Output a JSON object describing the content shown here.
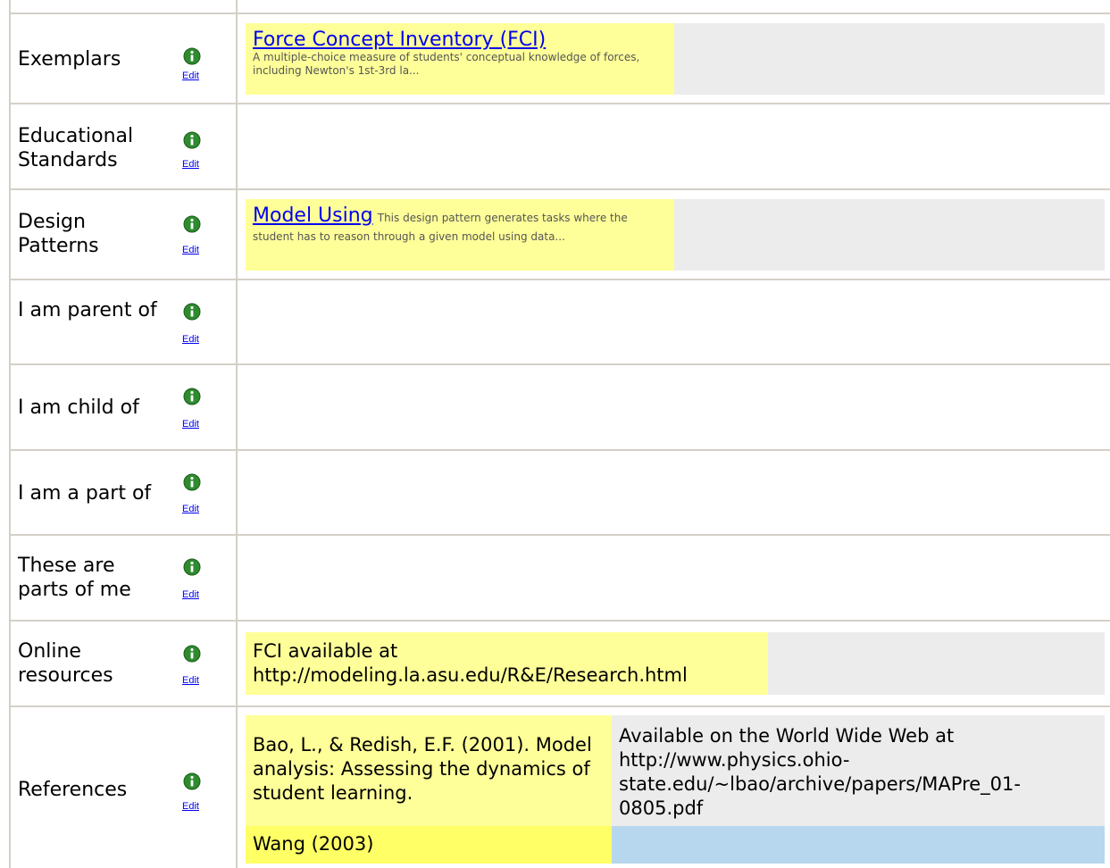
{
  "rows": [
    {
      "label": "Exemplars",
      "edit": "Edit",
      "item": {
        "title": "Force Concept Inventory (FCI)",
        "description": "A multiple-choice measure of students' conceptual knowledge of forces, including Newton's 1st-3rd la..."
      }
    },
    {
      "label": "Educational Standards",
      "edit": "Edit"
    },
    {
      "label": "Design Patterns",
      "edit": "Edit",
      "item": {
        "title": "Model Using",
        "description": "This design pattern generates tasks where the student has to reason through a given model using data..."
      }
    },
    {
      "label": "I am parent of",
      "edit": "Edit"
    },
    {
      "label": "I am child of",
      "edit": "Edit"
    },
    {
      "label": "I am a part of",
      "edit": "Edit"
    },
    {
      "label": "These are parts of me",
      "edit": "Edit"
    },
    {
      "label": "Online resources",
      "edit": "Edit",
      "text": "FCI available at http://modeling.la.asu.edu/R&E/Research.html"
    },
    {
      "label": "References",
      "edit": "Edit",
      "references": [
        {
          "citation": "Bao, L., & Redish, E.F. (2001). Model analysis: Assessing the dynamics of student learning.",
          "note": "Available on the World Wide Web at http://www.physics.ohio-state.edu/~lbao/archive/papers/MAPre_01-0805.pdf"
        },
        {
          "citation": "Wang (2003)",
          "note": ""
        }
      ]
    }
  ],
  "colors": {
    "highlight": "#ffff99",
    "highlight_strong": "#ffff66",
    "empty_cell": "#ececec",
    "note_blue": "#b7d7ee",
    "info_icon": "#2e8b2e",
    "grid": "#d4d0c8"
  },
  "icons": {
    "info": "info-icon"
  }
}
